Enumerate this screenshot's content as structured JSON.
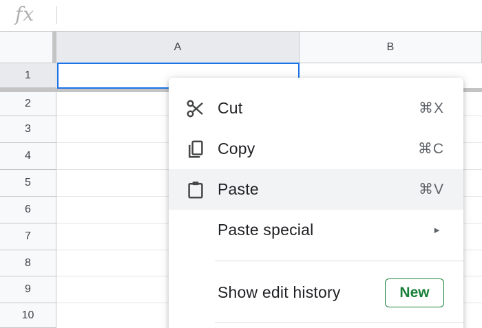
{
  "formula_bar": {
    "fx_label": "fx",
    "value": ""
  },
  "columns": [
    "A",
    "B"
  ],
  "rows": [
    "1",
    "2",
    "3",
    "4",
    "5",
    "6",
    "7",
    "8",
    "9",
    "10"
  ],
  "context_menu": {
    "items": [
      {
        "label": "Cut",
        "shortcut": "⌘X",
        "icon": "scissors-icon"
      },
      {
        "label": "Copy",
        "shortcut": "⌘C",
        "icon": "copy-icon"
      },
      {
        "label": "Paste",
        "shortcut": "⌘V",
        "icon": "clipboard-icon"
      },
      {
        "label": "Paste special",
        "submenu_arrow": "►"
      },
      {
        "label": "Show edit history",
        "badge": "New"
      }
    ]
  },
  "colors": {
    "selection": "#1a73e8",
    "badge": "#188038",
    "hover": "#f1f3f4"
  }
}
